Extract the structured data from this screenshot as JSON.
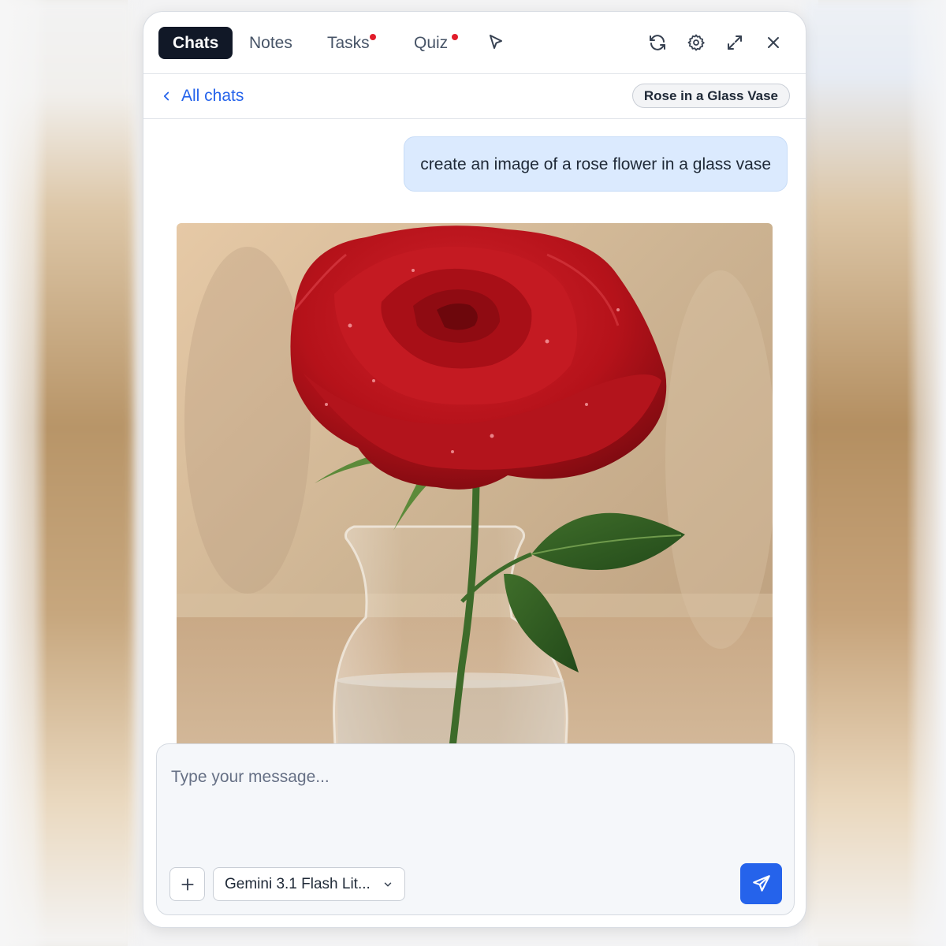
{
  "tabs": [
    {
      "label": "Chats",
      "active": true,
      "notification": false
    },
    {
      "label": "Notes",
      "active": false,
      "notification": false
    },
    {
      "label": "Tasks",
      "active": false,
      "notification": true
    },
    {
      "label": "Quiz",
      "active": false,
      "notification": true
    }
  ],
  "toolbar_icons": [
    "pointer-icon",
    "refresh-icon",
    "gear-icon",
    "expand-icon",
    "close-icon"
  ],
  "subheader": {
    "back_label": "All chats",
    "chat_title": "Rose in a Glass Vase"
  },
  "messages": [
    {
      "role": "user",
      "text": "create an image of a rose flower in a glass vase"
    },
    {
      "role": "assistant",
      "type": "image",
      "subject": "red rose in a glass vase"
    }
  ],
  "composer": {
    "placeholder": "Type your message...",
    "model": "Gemini 3.1 Flash Lit...",
    "attach_icon": "plus-icon",
    "send_icon": "send-icon"
  },
  "colors": {
    "accent": "#2563eb",
    "active_tab": "#111827",
    "notification_dot": "#e11d2a",
    "user_bubble": "#dbeafe"
  }
}
